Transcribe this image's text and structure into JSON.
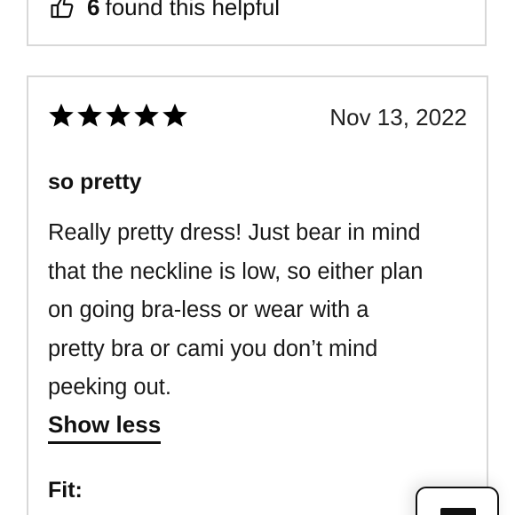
{
  "previous_review": {
    "helpful_count": "6",
    "helpful_text": "found this helpful",
    "thumb_icon": "thumbs-up-icon"
  },
  "review": {
    "rating": 5,
    "date": "Nov 13, 2022",
    "title": "so pretty",
    "body_lines": [
      "Really pretty dress! Just bear in mind",
      "that the neckline is low, so either plan",
      "on going bra-less or wear with a",
      "pretty bra or cami you don’t mind",
      "peeking out."
    ],
    "show_less_label": "Show less",
    "fit_label": "Fit:"
  },
  "colors": {
    "border": "#d8d8d8",
    "text": "#111111",
    "star": "#000000"
  }
}
